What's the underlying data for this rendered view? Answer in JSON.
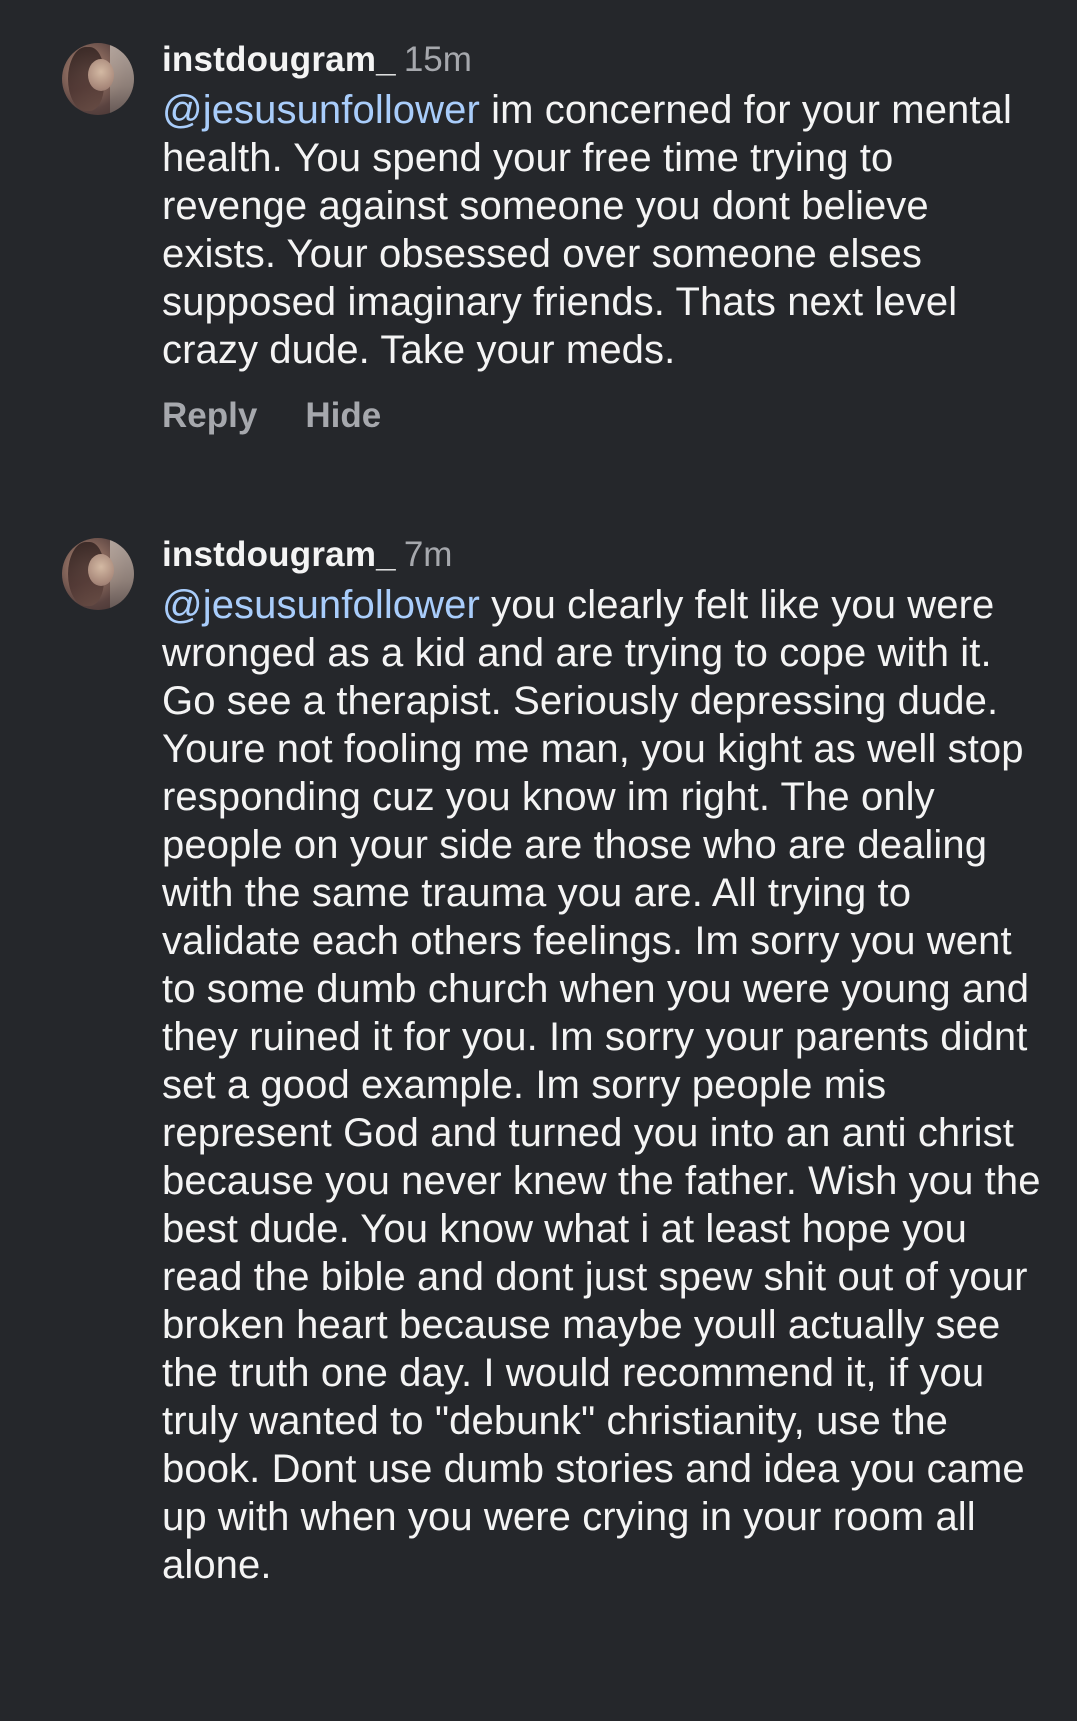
{
  "comments": [
    {
      "username": "instdougram_",
      "time": "15m",
      "mention": "@jesusunfollower",
      "text": " im concerned for your mental health. You spend your free time trying to revenge against someone you dont believe exists. Your obsessed over someone elses supposed imaginary friends. Thats next level crazy dude. Take your meds.",
      "reply_label": "Reply",
      "hide_label": "Hide"
    },
    {
      "username": "instdougram_",
      "time": "7m",
      "mention": "@jesusunfollower",
      "text": " you clearly felt like you were wronged as a kid and are trying to cope with it. Go see a therapist. Seriously depressing dude. Youre not fooling me man, you kight as well stop responding cuz you know im right. The only people on your side are those who are dealing with the same trauma you are. All trying to validate each others feelings. Im sorry you went to some dumb church when you were young and they ruined it for you. Im sorry your parents didnt set a good example. Im sorry people mis represent God and turned you into an anti christ because you never knew the father. Wish you the best dude. You know what i at least hope you read the bible and dont just spew shit out of your broken heart because maybe youll actually see the truth one day. I would recommend it, if you truly wanted to \"debunk\" christianity, use the book. Dont use dumb stories and idea you came up with when you were crying in your room all alone."
    }
  ],
  "icons": {
    "avatar": "user-avatar"
  },
  "colors": {
    "background": "#25272b",
    "text": "#f4f4f4",
    "secondary": "#a6a8ad",
    "mention": "#a9cdfb"
  }
}
